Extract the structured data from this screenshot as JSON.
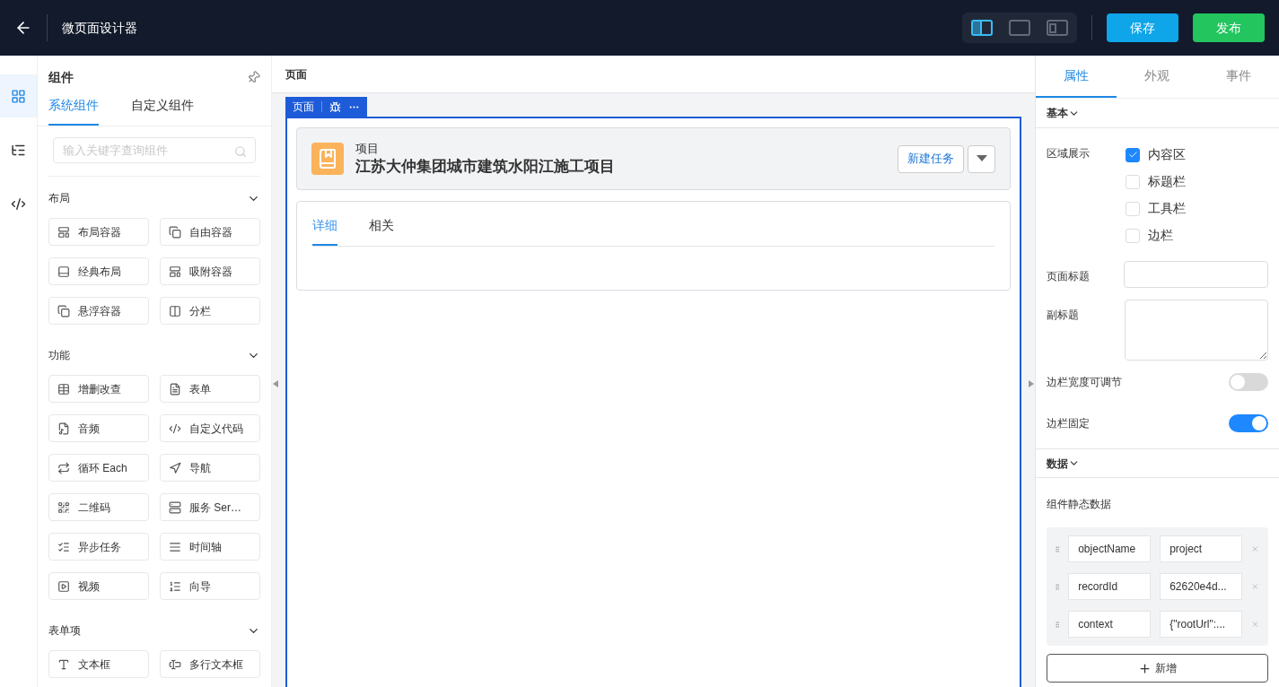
{
  "topbar": {
    "title": "微页面设计器",
    "views": [
      {
        "selected": true
      },
      {
        "selected": false
      },
      {
        "selected": false
      }
    ],
    "save": "保存",
    "publish": "发布"
  },
  "rail": [
    {
      "selected": true
    },
    {
      "selected": false
    },
    {
      "selected": false
    }
  ],
  "palette": {
    "title": "组件",
    "tabs": [
      {
        "label": "系统组件",
        "selected": true
      },
      {
        "label": "自定义组件",
        "selected": false
      }
    ],
    "search": {
      "placeholder": "输入关键字查询组件"
    },
    "groups": [
      {
        "title": "布局",
        "expanded": true,
        "items": [
          "布局容器",
          "自由容器",
          "经典布局",
          "吸附容器",
          "悬浮容器",
          "分栏"
        ]
      },
      {
        "title": "功能",
        "expanded": true,
        "items": [
          "增删改查",
          "表单",
          "音频",
          "自定义代码",
          "循环 Each",
          "导航",
          "二维码",
          "服务 Ser…",
          "异步任务",
          "时间轴",
          "视频",
          "向导"
        ]
      },
      {
        "title": "表单项",
        "expanded": true,
        "items": [
          "文本框",
          "多行文本框"
        ]
      }
    ]
  },
  "canvas": {
    "breadcrumb": "页面",
    "frame_label": "页面",
    "record": {
      "type": "项目",
      "name": "江苏大仲集团城市建筑水阳江施工项目",
      "action": "新建任务"
    },
    "tabs": [
      {
        "label": "详细",
        "selected": true
      },
      {
        "label": "相关",
        "selected": false
      }
    ]
  },
  "inspector": {
    "tabs": [
      {
        "label": "属性",
        "selected": true
      },
      {
        "label": "外观",
        "selected": false
      },
      {
        "label": "事件",
        "selected": false
      }
    ],
    "basic": {
      "title": "基本",
      "area_label": "区域展示",
      "areas": [
        {
          "label": "内容区",
          "checked": true
        },
        {
          "label": "标题栏",
          "checked": false
        },
        {
          "label": "工具栏",
          "checked": false
        },
        {
          "label": "边栏",
          "checked": false
        }
      ],
      "page_title_label": "页面标题",
      "subtitle_label": "副标题",
      "toggles": [
        {
          "label": "边栏宽度可调节",
          "on": false
        },
        {
          "label": "边栏固定",
          "on": true
        }
      ]
    },
    "data": {
      "title": "数据",
      "label": "组件静态数据",
      "rows": [
        {
          "key": "objectName",
          "value": "project"
        },
        {
          "key": "recordId",
          "value": "62620e4d..."
        },
        {
          "key": "context",
          "value": "{\"rootUrl\":..."
        }
      ],
      "add": "新增"
    }
  }
}
